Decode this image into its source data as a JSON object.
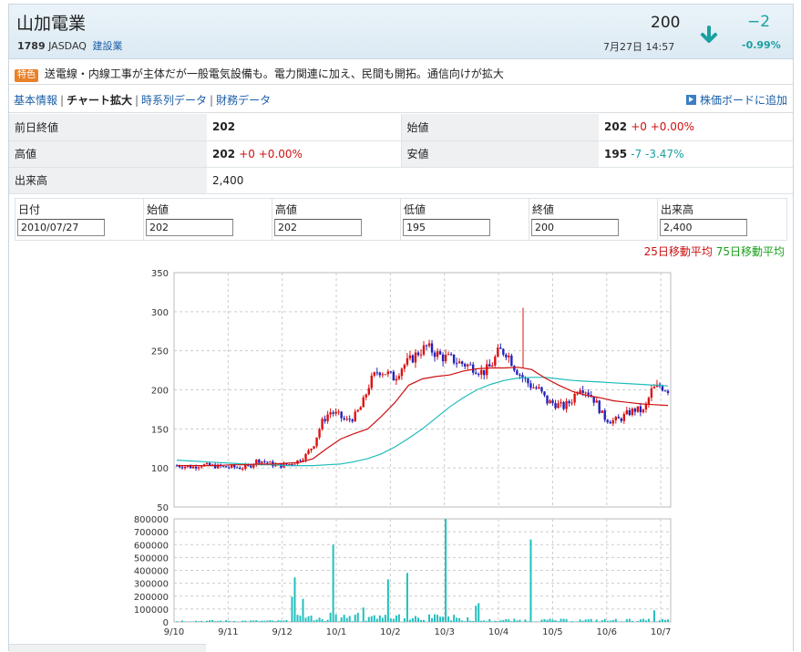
{
  "header": {
    "company": "山加電業",
    "code": "1789",
    "market": "JASDAQ",
    "sector": "建設業",
    "price": "200",
    "datetime": "7月27日 14:57",
    "change": "−2",
    "change_pct": "-0.99%",
    "arrow_icon": "down-arrow-icon",
    "change_color": "#1aa0a0"
  },
  "feature": {
    "badge": "特色",
    "text": "送電線・内線工事が主体だが一般電気設備も。電力関連に加え、民間も開拓。通信向けが拡大"
  },
  "nav": {
    "items": [
      "基本情報",
      "チャート拡大",
      "時系列データ",
      "財務データ"
    ],
    "current": 1,
    "board_label": "株価ボードに追加"
  },
  "quote": {
    "prev_close_label": "前日終値",
    "prev_close": "202",
    "open_label": "始値",
    "open": "202",
    "open_chg": "+0 +0.00%",
    "high_label": "高値",
    "high": "202",
    "high_chg": "+0 +0.00%",
    "low_label": "安値",
    "low": "195",
    "low_chg": "-7 -3.47%",
    "volume_label": "出来高",
    "volume": "2,400"
  },
  "ohlc": {
    "headers": [
      "日付",
      "始値",
      "高値",
      "低値",
      "終値",
      "出来高"
    ],
    "values": [
      "2010/07/27",
      "202",
      "202",
      "195",
      "200",
      "2,400"
    ]
  },
  "legend": {
    "ma25": "25日移動平均",
    "ma75": "75日移動平均",
    "ma25_color": "#cc1111",
    "ma75_color": "#1aa01a"
  },
  "chart_data": {
    "type": "candlestick",
    "price_axis": {
      "ticks": [
        50,
        100,
        150,
        200,
        250,
        300,
        350
      ],
      "ylim": [
        50,
        350
      ]
    },
    "volume_axis": {
      "ticks": [
        0,
        100000,
        200000,
        300000,
        400000,
        500000,
        600000,
        700000,
        800000
      ],
      "ylim": [
        0,
        800000
      ]
    },
    "x_ticks": [
      "9/10",
      "9/11",
      "9/12",
      "10/1",
      "10/2",
      "10/3",
      "10/4",
      "10/5",
      "10/6",
      "10/7"
    ],
    "up_color": "#dd1111",
    "down_color": "#2222bb",
    "ma25_color": "#cc1111",
    "ma75_color": "#22bbbb",
    "volume_color": "#22c0c0",
    "ma25_line": [
      103,
      103,
      103,
      103,
      104,
      104,
      105,
      105,
      106,
      107,
      112,
      125,
      137,
      144,
      150,
      166,
      184,
      206,
      214,
      217,
      219,
      224,
      227,
      228,
      228,
      229,
      226,
      215,
      206,
      198,
      193,
      190,
      186,
      184,
      182,
      181,
      180
    ],
    "ma75_line": [
      110,
      109,
      108,
      107,
      106,
      105,
      104,
      104,
      103,
      103,
      103,
      104,
      105,
      108,
      112,
      118,
      127,
      138,
      150,
      164,
      178,
      190,
      200,
      207,
      212,
      215,
      216,
      216,
      214,
      212,
      211,
      210,
      209,
      208,
      207,
      206,
      205
    ],
    "close_path": [
      103,
      102,
      101,
      104,
      103,
      102,
      101,
      101,
      100,
      102,
      110,
      108,
      104,
      103,
      105,
      109,
      116,
      130,
      158,
      172,
      168,
      160,
      165,
      180,
      210,
      225,
      222,
      215,
      230,
      238,
      248,
      255,
      248,
      242,
      240,
      235,
      232,
      228,
      222,
      230,
      250,
      248,
      228,
      215,
      205,
      200,
      185,
      182,
      178,
      186,
      205,
      198,
      185,
      165,
      160,
      162,
      170,
      175,
      172,
      200,
      205,
      200
    ],
    "volume_spikes": [
      [
        0.24,
        345000
      ],
      [
        0.32,
        600000
      ],
      [
        0.43,
        330000
      ],
      [
        0.47,
        380000
      ],
      [
        0.55,
        800000
      ],
      [
        0.72,
        640000
      ],
      [
        0.97,
        90000
      ]
    ]
  }
}
